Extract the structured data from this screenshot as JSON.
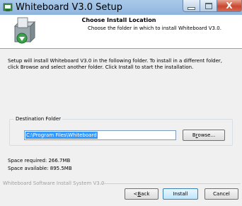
{
  "window": {
    "title": "Whiteboard V3.0 Setup",
    "close_glyph": "X"
  },
  "header": {
    "title": "Choose Install Location",
    "subtitle": "Choose the folder in which to install Whiteboard V3.0."
  },
  "body": {
    "description": "Setup will install Whiteboard V3.0 in the following folder. To install in a different folder, click Browse and select another folder. Click Install to start the installation."
  },
  "destination": {
    "label": "Destination Folder",
    "value": "C:\\Program Files\\Whiteboard",
    "browse_pre": "B",
    "browse_u": "r",
    "browse_post": "owse..."
  },
  "space": {
    "required": "Space required: 266.7MB",
    "available": "Space available: 895.5MB"
  },
  "branding": "Whiteboard Software Install System V3.0",
  "buttons": {
    "back_pre": "< ",
    "back_u": "B",
    "back_post": "ack",
    "install": "Install",
    "cancel": "Cancel"
  },
  "colors": {
    "selection": "#3399ff",
    "close_button": "#c8482f",
    "titlebar": "#a9c9ea"
  },
  "icons": {
    "app": "installer-app-icon",
    "header": "install-box-icon"
  }
}
